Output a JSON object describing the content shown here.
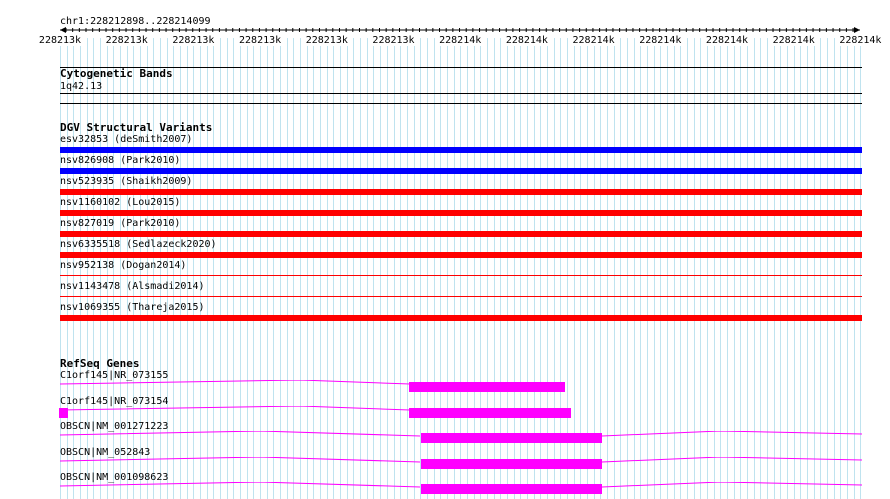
{
  "ruler": {
    "coordinates": "chr1:228212898..228214099",
    "ticks": [
      "228213k",
      "228213k",
      "228213k",
      "228213k",
      "228213k",
      "228213k",
      "228214k",
      "228214k",
      "228214k",
      "228214k",
      "228214k",
      "228214k",
      "228214k"
    ]
  },
  "cytobands": {
    "title": "Cytogenetic Bands",
    "band": "1q42.13"
  },
  "dgv": {
    "title": "DGV Structural Variants",
    "colors": {
      "gain": "#0000ff",
      "loss": "#ff0000"
    },
    "variants": [
      {
        "label": "esv32853 (deSmith2007)",
        "color": "#0000ff",
        "style": "bar"
      },
      {
        "label": "nsv826908 (Park2010)",
        "color": "#0000ff",
        "style": "bar"
      },
      {
        "label": "nsv523935 (Shaikh2009)",
        "color": "#ff0000",
        "style": "bar"
      },
      {
        "label": "nsv1160102 (Lou2015)",
        "color": "#ff0000",
        "style": "bar"
      },
      {
        "label": "nsv827019 (Park2010)",
        "color": "#ff0000",
        "style": "bar"
      },
      {
        "label": "nsv6335518 (Sedlazeck2020)",
        "color": "#ff0000",
        "style": "bar"
      },
      {
        "label": "nsv952138 (Dogan2014)",
        "color": "#ff0000",
        "style": "line"
      },
      {
        "label": "nsv1143478 (Alsmadi2014)",
        "color": "#ff0000",
        "style": "line"
      },
      {
        "label": "nsv1069355 (Thareja2015)",
        "color": "#ff0000",
        "style": "bar"
      }
    ]
  },
  "refseq": {
    "title": "RefSeq Genes",
    "color": "#ff00ff",
    "genes": [
      {
        "label": "C1orf145|NR_073155"
      },
      {
        "label": "C1orf145|NR_073154"
      },
      {
        "label": "OBSCN|NM_001271223"
      },
      {
        "label": "OBSCN|NM_052843"
      },
      {
        "label": "OBSCN|NM_001098623"
      }
    ]
  }
}
